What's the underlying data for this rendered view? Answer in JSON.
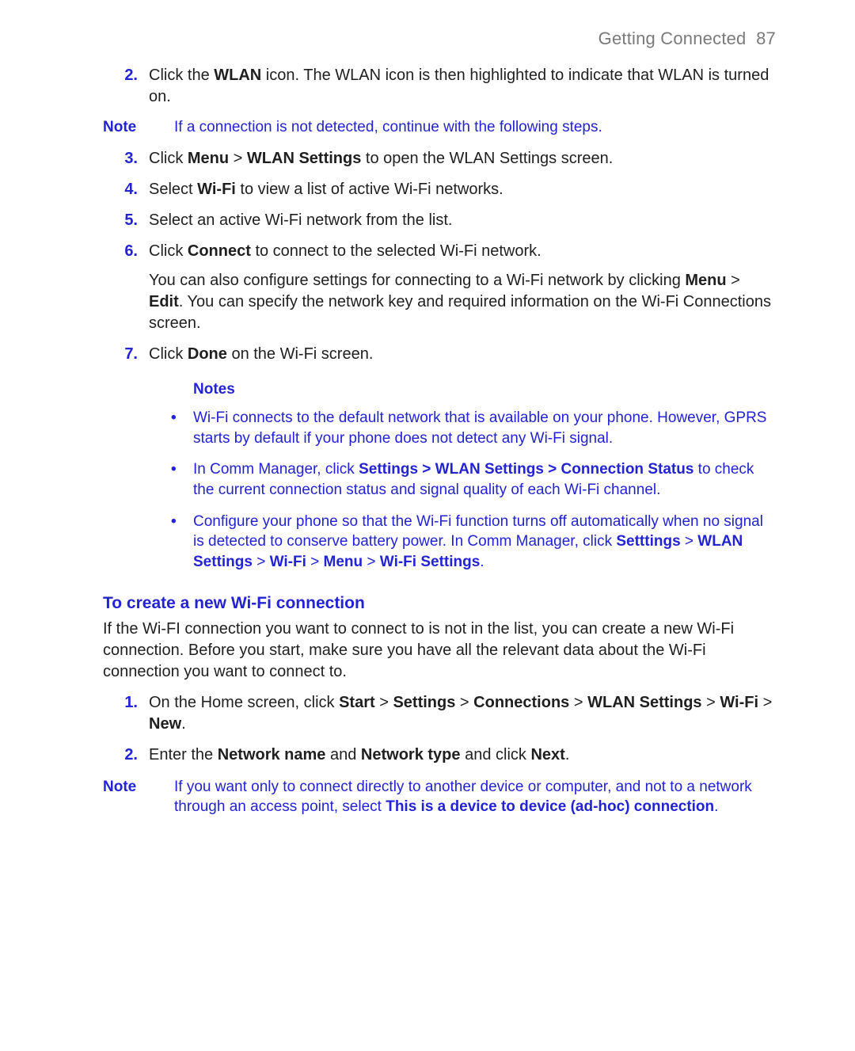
{
  "header": {
    "chapter": "Getting Connected",
    "page": "87"
  },
  "steps1": {
    "s2": {
      "num": "2.",
      "text_pre": "Click the ",
      "bold1": "WLAN",
      "text_post": " icon. The WLAN icon is then highlighted to indicate that WLAN is turned on."
    },
    "note1": {
      "label": "Note",
      "text": "If a connection is not detected, continue with the following steps."
    },
    "s3": {
      "num": "3.",
      "t1": "Click ",
      "b1": "Menu",
      "t2": " > ",
      "b2": "WLAN Settings",
      "t3": " to open the WLAN Settings screen."
    },
    "s4": {
      "num": "4.",
      "t1": "Select ",
      "b1": "Wi-Fi",
      "t2": " to view a list of active Wi-Fi networks."
    },
    "s5": {
      "num": "5.",
      "text": "Select an active Wi-Fi network from the list."
    },
    "s6": {
      "num": "6.",
      "t1": "Click ",
      "b1": "Connect",
      "t2": " to connect to the selected Wi-Fi network.",
      "p2_t1": "You can also configure settings for connecting to a Wi-Fi network by clicking ",
      "p2_b1": "Menu",
      "p2_t2": " > ",
      "p2_b2": "Edit",
      "p2_t3": ". You can specify the network key and required information on the Wi-Fi Connections screen."
    },
    "s7": {
      "num": "7.",
      "t1": "Click ",
      "b1": "Done",
      "t2": " on the Wi-Fi screen."
    }
  },
  "notes_block": {
    "heading": "Notes",
    "n1": "Wi-Fi connects to the default network that is available on your phone. However, GPRS starts by default if your phone does not detect any Wi-Fi signal.",
    "n2": {
      "t1": "In Comm Manager, click ",
      "b1": "Settings > WLAN Settings > Connection Status",
      "t2": " to check the current connection status and signal quality of each Wi-Fi channel."
    },
    "n3": {
      "t1": "Configure your phone so that the Wi-Fi function turns off automatically when no signal is detected to conserve battery power. In Comm Manager, click ",
      "b1": "Setttings",
      "t2": " > ",
      "b2": "WLAN Settings",
      "t3": " > ",
      "b3": "Wi-Fi",
      "t4": " > ",
      "b4": "Menu",
      "t5": " > ",
      "b5": "Wi-Fi Settings",
      "t6": "."
    }
  },
  "section2": {
    "heading": "To create a new Wi-Fi connection",
    "intro": "If the Wi-FI connection you want to connect to is not in the list, you can create a new Wi-Fi connection. Before you start, make sure you have all the relevant data about the Wi-Fi connection you want to connect to.",
    "s1": {
      "num": "1.",
      "t1": "On the Home screen, click ",
      "b1": "Start",
      "t2": " > ",
      "b2": "Settings",
      "t3": " > ",
      "b3": "Connections",
      "t4": " > ",
      "b4": "WLAN Settings",
      "t5": " > ",
      "b5": "Wi-Fi",
      "t6": " > ",
      "b6": "New",
      "t7": "."
    },
    "s2": {
      "num": "2.",
      "t1": "Enter the ",
      "b1": "Network name",
      "t2": " and ",
      "b2": "Network type",
      "t3": " and click ",
      "b3": "Next",
      "t4": "."
    },
    "note2": {
      "label": "Note",
      "t1": "If you want only to connect directly to another device or computer, and not to a network through an access point, select ",
      "b1": "This is a device to device (ad-hoc) connection",
      "t2": "."
    }
  }
}
